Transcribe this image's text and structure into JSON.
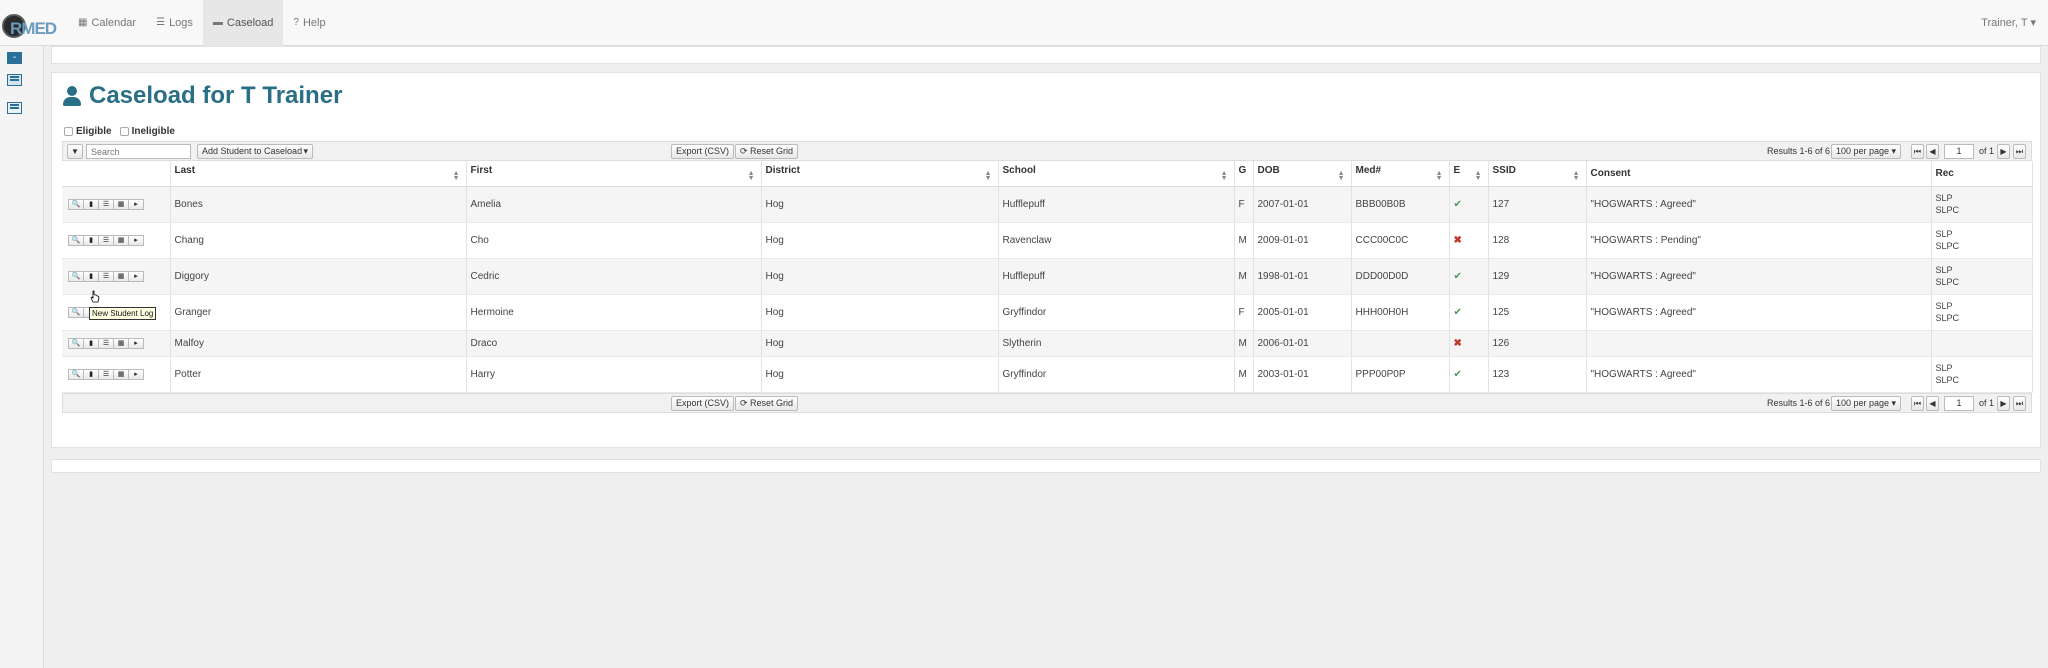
{
  "nav": {
    "logo_text": "RMED",
    "items": [
      {
        "label": "Calendar",
        "icon": "calendar-icon"
      },
      {
        "label": "Logs",
        "icon": "list-icon"
      },
      {
        "label": "Caseload",
        "icon": "briefcase-icon",
        "active": true
      },
      {
        "label": "Help",
        "icon": "help-icon"
      }
    ],
    "user": "Trainer, T ▾"
  },
  "page": {
    "title": "Caseload for T Trainer"
  },
  "filters": {
    "eligible": "Eligible",
    "ineligible": "Ineligible"
  },
  "toolbar": {
    "search_placeholder": "Search",
    "add_student": "Add Student to Caseload",
    "export": "Export (CSV)",
    "reset": "Reset Grid",
    "results": "Results 1-6  of 6",
    "per_page": "100 per page",
    "page": "1",
    "of": "of 1"
  },
  "table": {
    "columns": [
      "",
      "Last",
      "First",
      "District",
      "School",
      "G",
      "DOB",
      "Med#",
      "E",
      "SSID",
      "Consent",
      "Rec"
    ],
    "rows": [
      {
        "last": "Bones",
        "first": "Amelia",
        "district": "Hog",
        "school": "Hufflepuff",
        "g": "F",
        "dob": "2007-01-01",
        "med": "BBB00B0B",
        "e": "yes",
        "ssid": "127",
        "consent": "\"HOGWARTS : Agreed\"",
        "rec1": "SLP",
        "rec2": "SLPC"
      },
      {
        "last": "Chang",
        "first": "Cho",
        "district": "Hog",
        "school": "Ravenclaw",
        "g": "M",
        "dob": "2009-01-01",
        "med": "CCC00C0C",
        "e": "no",
        "ssid": "128",
        "consent": "\"HOGWARTS : Pending\"",
        "rec1": "SLP",
        "rec2": "SLPC"
      },
      {
        "last": "Diggory",
        "first": "Cedric",
        "district": "Hog",
        "school": "Hufflepuff",
        "g": "M",
        "dob": "1998-01-01",
        "med": "DDD00D0D",
        "e": "yes",
        "ssid": "129",
        "consent": "\"HOGWARTS : Agreed\"",
        "rec1": "SLP",
        "rec2": "SLPC"
      },
      {
        "last": "Granger",
        "first": "Hermoine",
        "district": "Hog",
        "school": "Gryffindor",
        "g": "F",
        "dob": "2005-01-01",
        "med": "HHH00H0H",
        "e": "yes",
        "ssid": "125",
        "consent": "\"HOGWARTS : Agreed\"",
        "rec1": "SLP",
        "rec2": "SLPC"
      },
      {
        "last": "Malfoy",
        "first": "Draco",
        "district": "Hog",
        "school": "Slytherin",
        "g": "M",
        "dob": "2006-01-01",
        "med": "",
        "e": "no",
        "ssid": "126",
        "consent": "",
        "rec1": "",
        "rec2": ""
      },
      {
        "last": "Potter",
        "first": "Harry",
        "district": "Hog",
        "school": "Gryffindor",
        "g": "M",
        "dob": "2003-01-01",
        "med": "PPP00P0P",
        "e": "yes",
        "ssid": "123",
        "consent": "\"HOGWARTS : Agreed\"",
        "rec1": "SLP",
        "rec2": "SLPC"
      }
    ]
  },
  "tooltip": "New Student Log",
  "glyphs": {
    "check": "✔",
    "cross": "✖"
  }
}
